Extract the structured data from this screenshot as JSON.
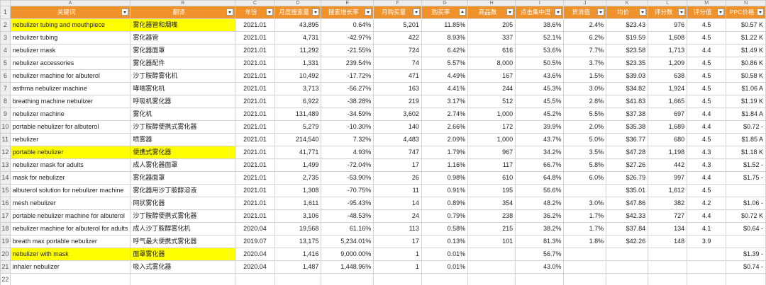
{
  "columns": [
    "A",
    "B",
    "C",
    "D",
    "E",
    "F",
    "G",
    "H",
    "I",
    "J",
    "K",
    "L",
    "M",
    "N"
  ],
  "headers": [
    "关键词",
    "翻译",
    "年份",
    "月度搜索量",
    "搜索增长率",
    "月购买量",
    "购买率",
    "商品数",
    "点击集中度",
    "货流值",
    "均价",
    "评分数",
    "评分值",
    "PPC价格"
  ],
  "rows": [
    {
      "n": "2",
      "hl": true,
      "cells": [
        "nebulizer tubing and mouthpiece",
        "雾化器管和烟嘴",
        "2021.01",
        "43,895",
        "0.64%",
        "5,201",
        "11.85%",
        "205",
        "38.6%",
        "2.4%",
        "$23.43",
        "976",
        "4.5",
        "$0.57 K"
      ]
    },
    {
      "n": "3",
      "hl": false,
      "cells": [
        "nebulizer tubing",
        "雾化器管",
        "2021.01",
        "4,731",
        "-42.97%",
        "422",
        "8.93%",
        "337",
        "52.1%",
        "6.2%",
        "$19.59",
        "1,608",
        "4.5",
        "$1.22 K"
      ]
    },
    {
      "n": "4",
      "hl": false,
      "cells": [
        "nebulizer mask",
        "雾化器面罩",
        "2021.01",
        "11,292",
        "-21.55%",
        "724",
        "6.42%",
        "616",
        "53.6%",
        "7.7%",
        "$23.58",
        "1,713",
        "4.4",
        "$1.49 K"
      ]
    },
    {
      "n": "5",
      "hl": false,
      "cells": [
        "nebulizer accessories",
        "雾化器配件",
        "2021.01",
        "1,331",
        "239.54%",
        "74",
        "5.57%",
        "8,000",
        "50.5%",
        "3.7%",
        "$23.35",
        "1,209",
        "4.5",
        "$0.86 K"
      ]
    },
    {
      "n": "6",
      "hl": false,
      "cells": [
        "nebulizer machine for albuterol",
        "沙丁胺醇雾化机",
        "2021.01",
        "10,492",
        "-17.72%",
        "471",
        "4.49%",
        "167",
        "43.6%",
        "1.5%",
        "$39.03",
        "638",
        "4.5",
        "$0.58 K"
      ]
    },
    {
      "n": "7",
      "hl": false,
      "cells": [
        "asthma nebulizer machine",
        "哮喘雾化机",
        "2021.01",
        "3,713",
        "-56.27%",
        "163",
        "4.41%",
        "244",
        "45.3%",
        "3.0%",
        "$34.82",
        "1,924",
        "4.5",
        "$1.06 A"
      ]
    },
    {
      "n": "8",
      "hl": false,
      "cells": [
        "breathing machine nebulizer",
        "呼吸机雾化器",
        "2021.01",
        "6,922",
        "-38.28%",
        "219",
        "3.17%",
        "512",
        "45.5%",
        "2.8%",
        "$41.83",
        "1,665",
        "4.5",
        "$1.19 K"
      ]
    },
    {
      "n": "9",
      "hl": false,
      "cells": [
        "nebulizer machine",
        "雾化机",
        "2021.01",
        "131,489",
        "-34.59%",
        "3,602",
        "2.74%",
        "1,000",
        "45.2%",
        "5.5%",
        "$37.38",
        "697",
        "4.4",
        "$1.84 A"
      ]
    },
    {
      "n": "10",
      "hl": false,
      "cells": [
        "portable nebulizer for albuterol",
        "沙丁胺醇便携式雾化器",
        "2021.01",
        "5,279",
        "-10.30%",
        "140",
        "2.66%",
        "172",
        "39.9%",
        "2.0%",
        "$35.38",
        "1,689",
        "4.4",
        "$0.72 -"
      ]
    },
    {
      "n": "11",
      "hl": false,
      "cells": [
        "nebulizer",
        "喷雾器",
        "2021.01",
        "214,540",
        "7.32%",
        "4,483",
        "2.09%",
        "1,000",
        "43.7%",
        "5.0%",
        "$36.77",
        "680",
        "4.5",
        "$1.85 A"
      ]
    },
    {
      "n": "12",
      "hl": true,
      "cells": [
        "portable nebulizer",
        "便携式雾化器",
        "2021.01",
        "41,771",
        "4.93%",
        "747",
        "1.79%",
        "967",
        "34.2%",
        "3.5%",
        "$47.28",
        "1,198",
        "4.3",
        "$1.18 K"
      ]
    },
    {
      "n": "13",
      "hl": false,
      "cells": [
        "nebulizer mask for adults",
        "成人雾化器面罩",
        "2021.01",
        "1,499",
        "-72.04%",
        "17",
        "1.16%",
        "117",
        "66.7%",
        "5.8%",
        "$27.26",
        "442",
        "4.3",
        "$1.52 -"
      ]
    },
    {
      "n": "14",
      "hl": false,
      "cells": [
        "mask for nebulizer",
        "雾化器面罩",
        "2021.01",
        "2,735",
        "-53.90%",
        "26",
        "0.98%",
        "610",
        "64.8%",
        "6.0%",
        "$26.79",
        "997",
        "4.4",
        "$1.75 -"
      ]
    },
    {
      "n": "15",
      "hl": false,
      "cells": [
        "albuterol solution for nebulizer machine",
        "雾化器用沙丁胺醇溶液",
        "2021.01",
        "1,308",
        "-70.75%",
        "11",
        "0.91%",
        "195",
        "56.6%",
        "",
        "$35.01",
        "1,612",
        "4.5",
        ""
      ]
    },
    {
      "n": "16",
      "hl": false,
      "cells": [
        "mesh nebulizer",
        "网状雾化器",
        "2021.01",
        "1,611",
        "-95.43%",
        "14",
        "0.89%",
        "354",
        "48.2%",
        "3.0%",
        "$47.86",
        "382",
        "4.2",
        "$1.06 -"
      ]
    },
    {
      "n": "17",
      "hl": false,
      "cells": [
        "portable nebulizer machine for albuterol",
        "沙丁胺醇便携式雾化器",
        "2021.01",
        "3,106",
        "-48.53%",
        "24",
        "0.79%",
        "238",
        "36.2%",
        "1.7%",
        "$42.33",
        "727",
        "4.4",
        "$0.72 K"
      ]
    },
    {
      "n": "18",
      "hl": false,
      "cells": [
        "nebulizer machine for albuterol for adults",
        "成人沙丁胺醇雾化机",
        "2020.04",
        "19,568",
        "61.16%",
        "113",
        "0.58%",
        "215",
        "38.2%",
        "1.7%",
        "$37.84",
        "134",
        "4.1",
        "$0.64 -"
      ]
    },
    {
      "n": "19",
      "hl": false,
      "cells": [
        "breath max portable nebulizer",
        "呼气最大便携式雾化器",
        "2019.07",
        "13,175",
        "5,234.01%",
        "17",
        "0.13%",
        "101",
        "81.3%",
        "1.8%",
        "$42.26",
        "148",
        "3.9",
        ""
      ]
    },
    {
      "n": "20",
      "hl": true,
      "cells": [
        "nebulizer with mask",
        "面罩雾化器",
        "2020.04",
        "1,416",
        "9,000.00%",
        "1",
        "0.01%",
        "",
        "56.7%",
        "",
        "",
        "",
        "",
        "$1.39 -"
      ]
    },
    {
      "n": "21",
      "hl": false,
      "cells": [
        "inhaler nebulizer",
        "吸入式雾化器",
        "2020.04",
        "1,487",
        "1,448.96%",
        "1",
        "0.01%",
        "",
        "43.0%",
        "",
        "",
        "",
        "",
        "$0.74 -"
      ]
    }
  ],
  "empty_rows": [
    "22",
    "23"
  ],
  "colors": {
    "header": "#f0922b",
    "highlight": "#ffff00",
    "grid": "#d4d4d4"
  }
}
